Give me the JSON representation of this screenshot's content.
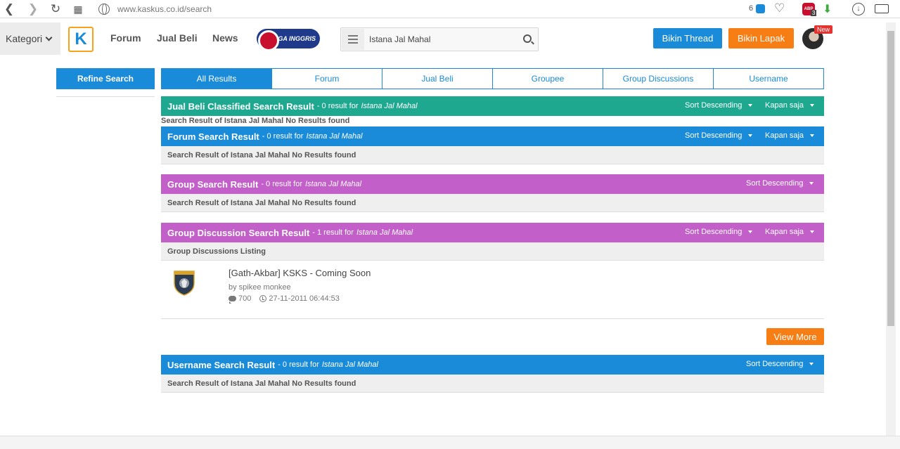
{
  "browser": {
    "url": "www.kaskus.co.id/search",
    "count_badge": "6",
    "abp_count": "3",
    "abp_label": "ABP"
  },
  "header": {
    "kategori": "Kategori",
    "logo": "K",
    "nav": [
      "Forum",
      "Jual Beli",
      "News"
    ],
    "liga_label": "LIGA INGGRIS",
    "search_value": "Istana Jal Mahal",
    "bikin_thread": "Bikin Thread",
    "bikin_lapak": "Bikin Lapak",
    "new_badge": "New"
  },
  "sidebar": {
    "refine": "Refine Search"
  },
  "tabs": [
    "All Results",
    "Forum",
    "Jual Beli",
    "Groupee",
    "Group Discussions",
    "Username"
  ],
  "sections": {
    "jual_beli": {
      "title": "Jual Beli Classified Search Result",
      "sub": "- 0 result for",
      "query": "Istana Jal Mahal",
      "sort": "Sort Descending",
      "time": "Kapan saja",
      "body": "Search Result of Istana Jal Mahal No Results found"
    },
    "forum": {
      "title": "Forum Search Result",
      "sub": "- 0 result for",
      "query": "Istana Jal Mahal",
      "sort": "Sort Descending",
      "time": "Kapan saja",
      "body": "Search Result of Istana Jal Mahal No Results found"
    },
    "group": {
      "title": "Group Search Result",
      "sub": "- 0 result for",
      "query": "Istana Jal Mahal",
      "sort": "Sort Descending",
      "body": "Search Result of Istana Jal Mahal No Results found"
    },
    "group_discussion": {
      "title": "Group Discussion Search Result",
      "sub": "- 1 result for",
      "query": "Istana Jal Mahal",
      "sort": "Sort Descending",
      "time": "Kapan saja",
      "listing": "Group Discussions Listing",
      "item": {
        "title": "[Gath-Akbar] KSKS - Coming Soon",
        "by": "by spikee monkee",
        "comments": "700",
        "date": "27-11-2011 06:44:53"
      },
      "view_more": "View More"
    },
    "username": {
      "title": "Username Search Result",
      "sub": "- 0 result for",
      "query": "Istana Jal Mahal",
      "sort": "Sort Descending",
      "body": "Search Result of Istana Jal Mahal No Results found"
    }
  },
  "colors": {
    "blue": "#1a8bd9",
    "orange": "#f77d15",
    "teal": "#1fa890",
    "purple": "#c25fc9"
  }
}
